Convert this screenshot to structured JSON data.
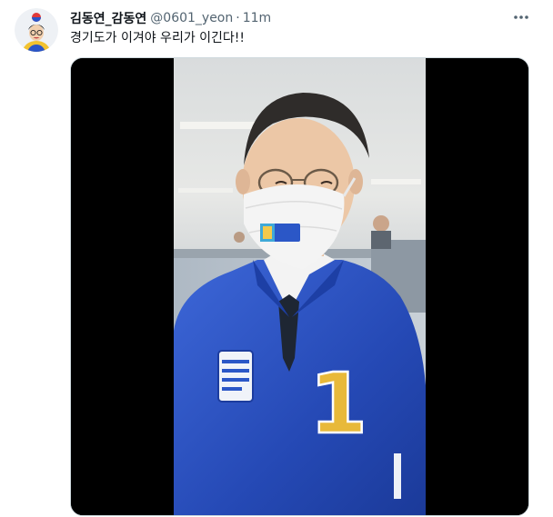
{
  "tweet": {
    "display_name": "김동연_감동연",
    "handle": "@0601_yeon",
    "separator": "·",
    "time": "11m",
    "text": "경기도가 이겨야 우리가 이긴다!!"
  },
  "media": {
    "type": "video",
    "vest_number": "1"
  },
  "icons": {
    "more": "more-horizontal-icon"
  },
  "colors": {
    "text_primary": "#0f1419",
    "text_secondary": "#536471",
    "media_background": "#000000",
    "jacket_blue": "#2b52c4",
    "number_yellow": "#e8b93a"
  }
}
